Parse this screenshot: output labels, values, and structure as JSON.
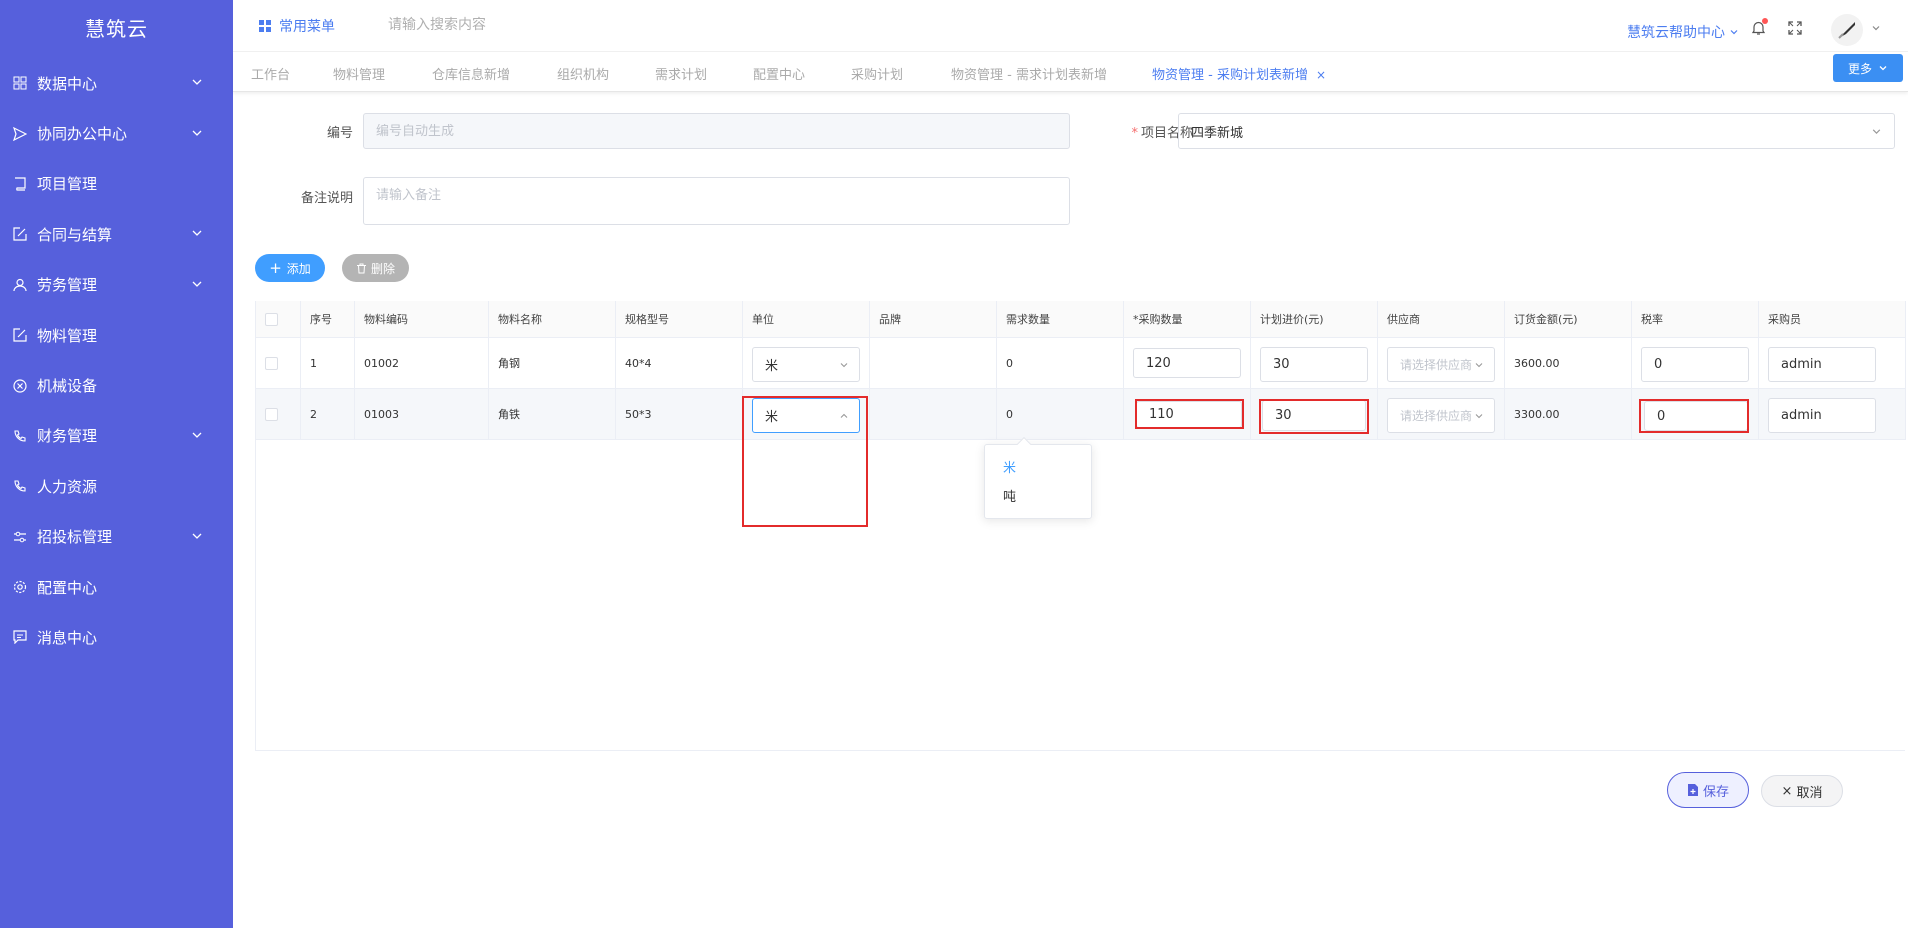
{
  "sidebar": {
    "brand": "慧筑云",
    "items": [
      {
        "label": "数据中心",
        "icon": "grid-icon",
        "has_children": true
      },
      {
        "label": "协同办公中心",
        "icon": "send-icon",
        "has_children": true
      },
      {
        "label": "项目管理",
        "icon": "book-icon",
        "has_children": false
      },
      {
        "label": "合同与结算",
        "icon": "edit-icon",
        "has_children": true
      },
      {
        "label": "劳务管理",
        "icon": "user-icon",
        "has_children": true
      },
      {
        "label": "物料管理",
        "icon": "edit-icon",
        "has_children": false
      },
      {
        "label": "机械设备",
        "icon": "circle-x-icon",
        "has_children": false
      },
      {
        "label": "财务管理",
        "icon": "phone-icon",
        "has_children": true
      },
      {
        "label": "人力资源",
        "icon": "phone-icon",
        "has_children": false
      },
      {
        "label": "招投标管理",
        "icon": "sliders-icon",
        "has_children": true
      },
      {
        "label": "配置中心",
        "icon": "gear-icon",
        "has_children": false
      },
      {
        "label": "消息中心",
        "icon": "message-icon",
        "has_children": false
      }
    ]
  },
  "header": {
    "common_menu": "常用菜单",
    "search_placeholder": "请输入搜索内容",
    "help": "慧筑云帮助中心"
  },
  "tabs": [
    {
      "label": "工作台",
      "active": false
    },
    {
      "label": "物料管理",
      "active": false
    },
    {
      "label": "仓库信息新增",
      "active": false
    },
    {
      "label": "组织机构",
      "active": false
    },
    {
      "label": "需求计划",
      "active": false
    },
    {
      "label": "配置中心",
      "active": false
    },
    {
      "label": "采购计划",
      "active": false
    },
    {
      "label": "物资管理 - 需求计划表新增",
      "active": false
    },
    {
      "label": "物资管理 - 采购计划表新增",
      "active": true
    }
  ],
  "more_label": "更多",
  "form": {
    "code_label": "编号",
    "code_placeholder": "编号自动生成",
    "project_label": "项目名称",
    "project_value": "四季新城",
    "remark_label": "备注说明",
    "remark_placeholder": "请输入备注"
  },
  "actions": {
    "add": "添加",
    "delete": "删除"
  },
  "table": {
    "headers": [
      "序号",
      "物料编码",
      "物料名称",
      "规格型号",
      "单位",
      "品牌",
      "需求数量",
      "*采购数量",
      "计划进价(元)",
      "供应商",
      "订货金额(元)",
      "税率",
      "采购员"
    ],
    "supplier_placeholder": "请选择供应商",
    "rows": [
      {
        "index": "1",
        "code": "01002",
        "name": "角钢",
        "spec": "40*4",
        "unit": "米",
        "brand": "",
        "demand": "0",
        "qty": "120",
        "price": "30",
        "amount": "3600.00",
        "tax": "0",
        "buyer": "admin"
      },
      {
        "index": "2",
        "code": "01003",
        "name": "角铁",
        "spec": "50*3",
        "unit": "米",
        "brand": "",
        "demand": "0",
        "qty": "110",
        "price": "30",
        "amount": "3300.00",
        "tax": "0",
        "buyer": "admin"
      }
    ]
  },
  "unit_dropdown": {
    "options": [
      "米",
      "吨"
    ],
    "selected": "米"
  },
  "footer": {
    "save": "保存",
    "cancel": "取消"
  },
  "colors": {
    "sidebar_bg": "#5660dc",
    "accent": "#409eff",
    "highlight_box": "#e32b2b"
  }
}
